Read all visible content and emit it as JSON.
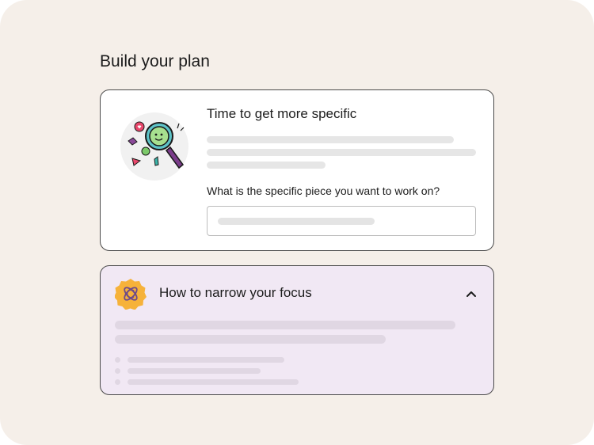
{
  "page": {
    "title": "Build your plan"
  },
  "specific_card": {
    "illustration": "magnifying-glass-illustration",
    "title": "Time to get more specific",
    "question_label": "What is the specific piece you want to work on?",
    "answer_field": {
      "value": "",
      "placeholder": ""
    }
  },
  "focus_card": {
    "badge_icon": "atom-badge-icon",
    "title": "How to narrow your focus",
    "toggle_icon": "chevron-up-icon",
    "expanded": true
  },
  "colors": {
    "background": "#f5efe9",
    "card_white": "#ffffff",
    "card_lavender": "#f1e8f4",
    "skeleton_grey": "#e6e6e6",
    "skeleton_lavender": "#e0d7e3",
    "badge_orange": "#f6b23a",
    "atom_purple": "#6e4a8a"
  }
}
